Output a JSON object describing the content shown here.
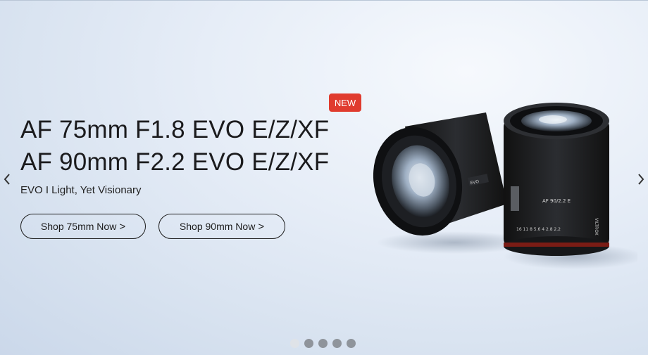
{
  "hero": {
    "badge": "NEW",
    "title_line1": "AF 75mm F1.8 EVO E/Z/XF",
    "title_line2": "AF 90mm F2.2 EVO E/Z/XF",
    "subtitle": "EVO I Light, Yet Visionary",
    "buttons": [
      {
        "label": "Shop 75mm Now",
        "icon": "chevron-right-icon"
      },
      {
        "label": "Shop 90mm Now",
        "icon": "chevron-right-icon"
      }
    ]
  },
  "carousel": {
    "prev_icon": "chevron-left-icon",
    "next_icon": "chevron-right-icon",
    "slide_count": 5,
    "active_index": 0
  },
  "lens_markings": {
    "front_lens_model": "AF 90/2.2 E",
    "brand": "VILTROX",
    "evo": "EVO",
    "scale": "16  11  8  5.6  4  2.8  2.2"
  }
}
